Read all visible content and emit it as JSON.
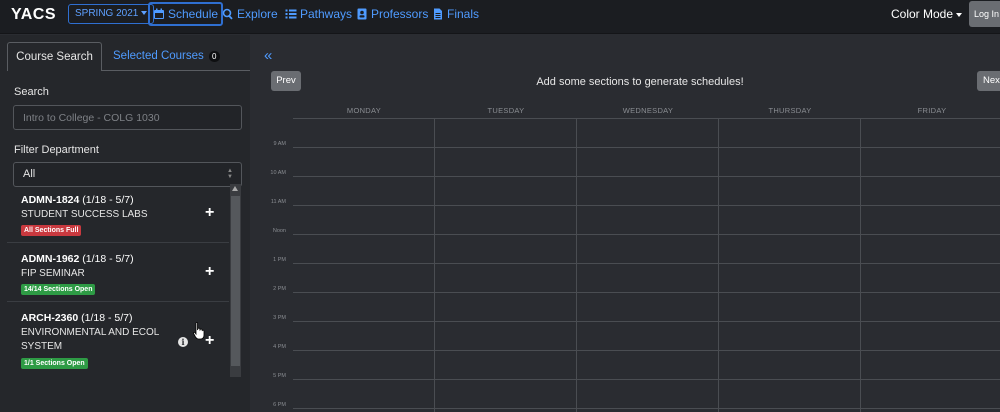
{
  "nav": {
    "brand": "YACS",
    "semester": "SPRING 2021",
    "links": [
      {
        "label": "Schedule",
        "icon": "calendar-icon"
      },
      {
        "label": "Explore",
        "icon": "search-icon"
      },
      {
        "label": "Pathways",
        "icon": "list-icon"
      },
      {
        "label": "Professors",
        "icon": "contact-card-icon"
      },
      {
        "label": "Finals",
        "icon": "document-icon"
      }
    ],
    "color_mode": "Color Mode",
    "login": "Log In"
  },
  "sidebar": {
    "tab_search": "Course Search",
    "tab_selected": "Selected Courses",
    "selected_count": "0",
    "search_label": "Search",
    "search_placeholder": "Intro to College - COLG 1030",
    "filter_label": "Filter Department",
    "filter_value": "All",
    "courses": [
      {
        "code": "ADMN-1824",
        "dates": "(1/18 - 5/7)",
        "name": "STUDENT SUCCESS LABS",
        "status": "All Sections Full",
        "status_type": "full"
      },
      {
        "code": "ADMN-1962",
        "dates": "(1/18 - 5/7)",
        "name": "FIP SEMINAR",
        "status": "14/14 Sections Open",
        "status_type": "open"
      },
      {
        "code": "ARCH-2360",
        "dates": "(1/18 - 5/7)",
        "name": "ENVIRONMENTAL AND ECOL SYSTEM",
        "status": "1/1 Sections Open",
        "status_type": "open"
      }
    ]
  },
  "schedule": {
    "prev": "Prev",
    "next": "Next",
    "message": "Add some sections to generate schedules!",
    "days": [
      "Monday",
      "Tuesday",
      "Wednesday",
      "Thursday",
      "Friday"
    ],
    "times": [
      "9 AM",
      "10 AM",
      "11 AM",
      "Noon",
      "1 PM",
      "2 PM",
      "3 PM",
      "4 PM",
      "5 PM",
      "6 PM"
    ]
  },
  "colors": {
    "accent": "#4f9bff",
    "background": "#2a2c31",
    "navbar": "#1b1d21",
    "status_full": "#c9393f",
    "status_open": "#2e9b45"
  }
}
